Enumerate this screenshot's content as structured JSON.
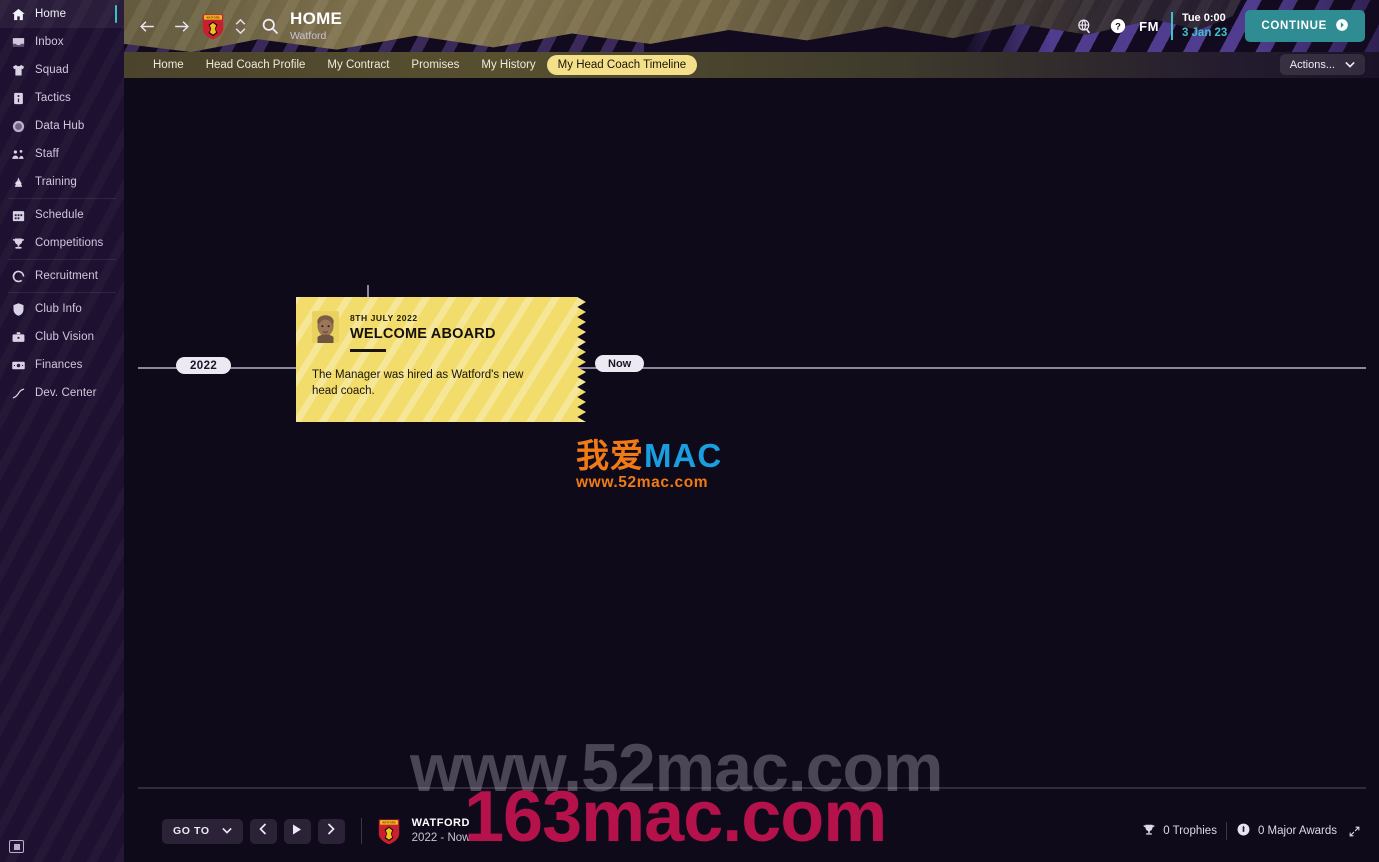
{
  "sidebar": {
    "items": [
      {
        "label": "Home",
        "icon": "home-icon",
        "active": true
      },
      {
        "label": "Inbox",
        "icon": "inbox-icon",
        "active": false
      },
      {
        "label": "Squad",
        "icon": "shirt-icon",
        "active": false
      },
      {
        "label": "Tactics",
        "icon": "tactics-icon",
        "active": false
      },
      {
        "label": "Data Hub",
        "icon": "data-hub-icon",
        "active": false
      },
      {
        "label": "Staff",
        "icon": "staff-icon",
        "active": false
      },
      {
        "label": "Training",
        "icon": "training-icon",
        "active": false
      },
      {
        "label": "Schedule",
        "icon": "calendar-icon",
        "active": false
      },
      {
        "label": "Competitions",
        "icon": "trophy-icon",
        "active": false
      },
      {
        "label": "Recruitment",
        "icon": "recruitment-icon",
        "active": false
      },
      {
        "label": "Club Info",
        "icon": "shield-icon",
        "active": false
      },
      {
        "label": "Club Vision",
        "icon": "briefcase-icon",
        "active": false
      },
      {
        "label": "Finances",
        "icon": "money-icon",
        "active": false
      },
      {
        "label": "Dev. Center",
        "icon": "growth-icon",
        "active": false
      }
    ]
  },
  "header": {
    "back_icon": "arrow-left-icon",
    "forward_icon": "arrow-right-icon",
    "club_badge": "watford-badge-icon",
    "club_switch_icon": "chevron-updown-icon",
    "search_icon": "search-icon",
    "title": "HOME",
    "subtitle": "Watford",
    "globe_icon": "globe-icon",
    "help_icon": "help-icon",
    "fm_logo": "FM",
    "time": "Tue 0:00",
    "date": "3 Jan 23",
    "continue_label": "CONTINUE",
    "continue_icon": "arrow-circle-right-icon",
    "accent_color": "#2e8c92",
    "date_color": "#3fc0c6"
  },
  "tabs": [
    {
      "label": "Home",
      "active": false
    },
    {
      "label": "Head Coach Profile",
      "active": false
    },
    {
      "label": "My Contract",
      "active": false
    },
    {
      "label": "Promises",
      "active": false
    },
    {
      "label": "My History",
      "active": false
    },
    {
      "label": "My Head Coach Timeline",
      "active": true
    }
  ],
  "actions": {
    "label": "Actions...",
    "icon": "chevron-down-icon"
  },
  "timeline": {
    "year_pill": "2022",
    "now_pill": "Now",
    "node_marker": "timeline-node-icon",
    "card": {
      "date": "8TH JULY 2022",
      "title": "WELCOME ABOARD",
      "description": "The Manager was hired as Watford's new head coach.",
      "avatar": "manager-portrait",
      "background_color": "#f2dc6b"
    }
  },
  "bottom_bar": {
    "goto_label": "GO TO",
    "goto_icon": "chevron-down-icon",
    "prev_icon": "chevron-left-icon",
    "play_icon": "play-icon",
    "next_icon": "chevron-right-icon",
    "club_badge": "watford-badge-icon",
    "club_name": "WATFORD",
    "club_range": "2022 - Now",
    "trophies_icon": "trophy-icon",
    "trophies_label": "0 Trophies",
    "awards_icon": "medal-icon",
    "awards_label": "0 Major Awards",
    "expand_icon": "expand-icon"
  },
  "watermarks": {
    "logo_cn": "我爱",
    "logo_en": "MAC",
    "logo_url": "www.52mac.com",
    "gray_text": "www.52mac.com",
    "red_text": "163mac.com",
    "orange_color": "#f07a16",
    "blue_color": "#1a9ee0",
    "red_color": "#c81250"
  }
}
